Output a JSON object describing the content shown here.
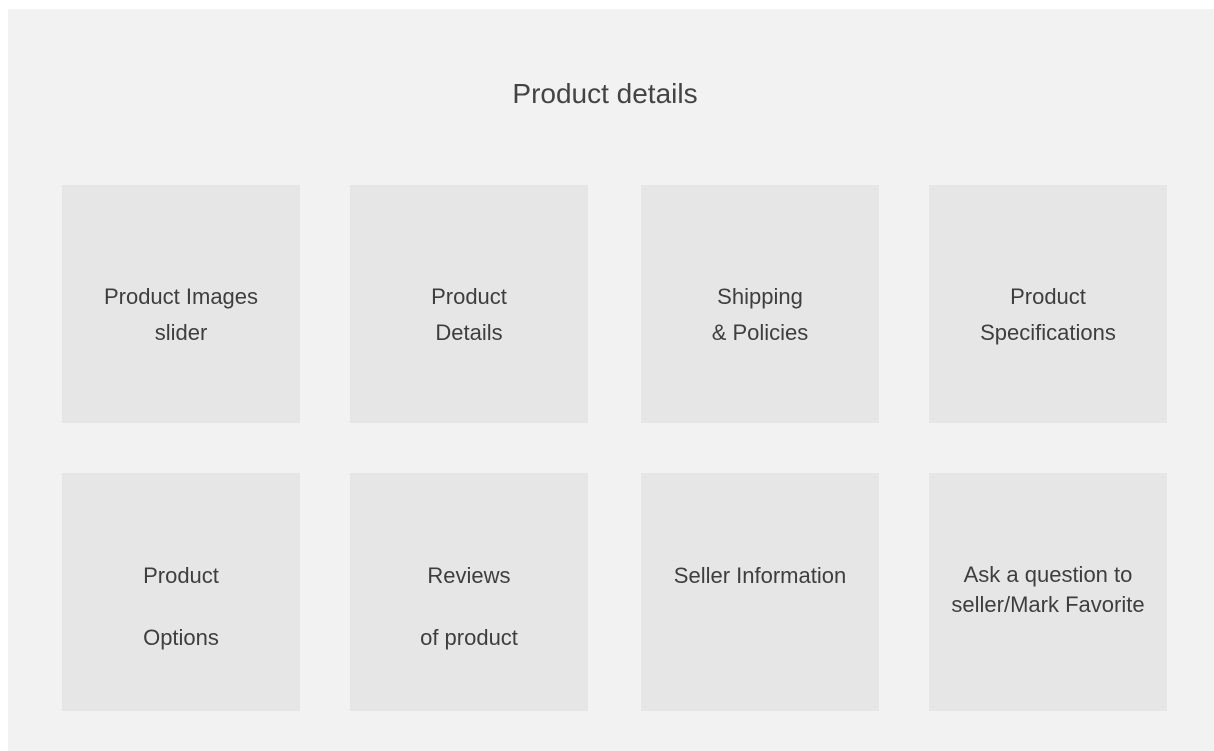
{
  "title": "Product details",
  "sections": {
    "images": {
      "line1": "Product Images",
      "line2": "slider"
    },
    "details": {
      "line1": "Product",
      "line2": "Details"
    },
    "shipping": {
      "line1": "Shipping",
      "line2": "& Policies"
    },
    "specifications": {
      "line1": "Product",
      "line2": "Specifications"
    },
    "options": {
      "line1": "Product",
      "line2": "Options"
    },
    "reviews": {
      "line1": "Reviews",
      "line2": "of product"
    },
    "seller": {
      "line1": "Seller Information"
    },
    "ask": {
      "text": "Ask a question to seller/Mark Favorite"
    }
  }
}
